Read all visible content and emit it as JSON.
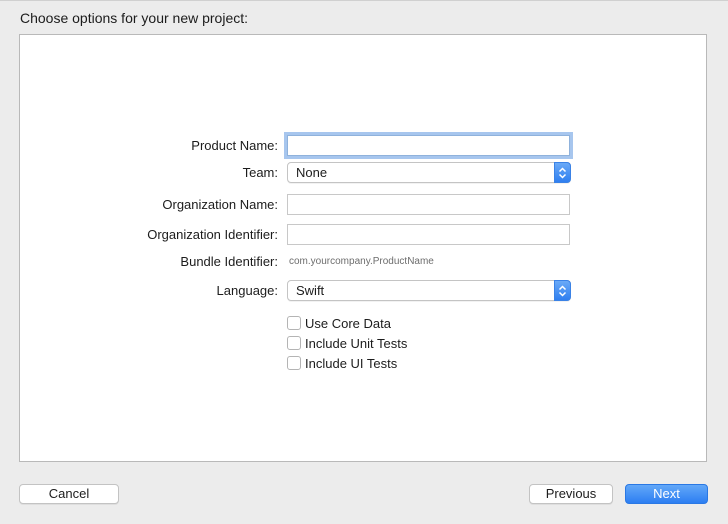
{
  "dialog": {
    "title": "Choose options for your new project:"
  },
  "form": {
    "product_name": {
      "label": "Product Name:",
      "value": ""
    },
    "team": {
      "label": "Team:",
      "selected": "None"
    },
    "organization_name": {
      "label": "Organization Name:",
      "value": ""
    },
    "organization_identifier": {
      "label": "Organization Identifier:",
      "value": ""
    },
    "bundle_identifier": {
      "label": "Bundle Identifier:",
      "value": "com.yourcompany.ProductName"
    },
    "language": {
      "label": "Language:",
      "selected": "Swift"
    },
    "checkboxes": [
      {
        "label": "Use Core Data",
        "checked": false
      },
      {
        "label": "Include Unit Tests",
        "checked": false
      },
      {
        "label": "Include UI Tests",
        "checked": false
      }
    ]
  },
  "buttons": {
    "cancel": "Cancel",
    "previous": "Previous",
    "next": "Next"
  },
  "colors": {
    "accent": "#2f7ff0",
    "focus_ring": "#a7c6ee",
    "background": "#ececec",
    "panel": "#ffffff"
  },
  "icons": {
    "popup_arrows": "chevron-up-down-icon"
  }
}
